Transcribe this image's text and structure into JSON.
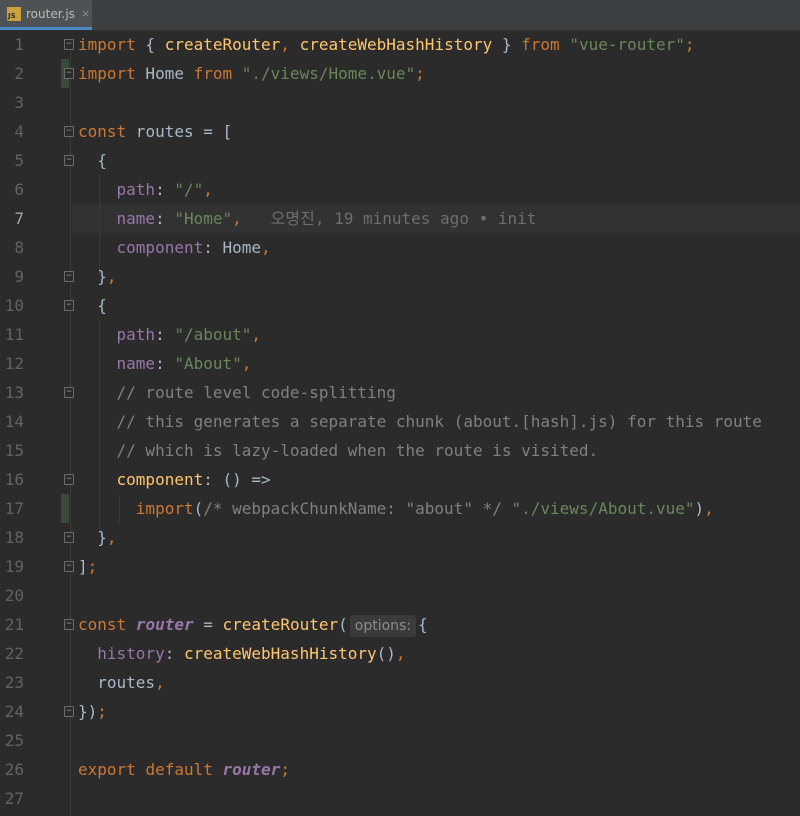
{
  "tab": {
    "name": "router.js",
    "icon": "js-file-icon",
    "close": "×",
    "badge": "JS"
  },
  "gutter": {
    "lines": [
      "1",
      "2",
      "3",
      "4",
      "5",
      "6",
      "7",
      "8",
      "9",
      "10",
      "11",
      "12",
      "13",
      "14",
      "15",
      "16",
      "17",
      "18",
      "19",
      "20",
      "21",
      "22",
      "23",
      "24",
      "25",
      "26",
      "27"
    ]
  },
  "code": {
    "l1": {
      "import": "import",
      "open": " { ",
      "f1": "createRouter",
      "comma": ",",
      "sp": " ",
      "f2": "createWebHashHistory",
      "close": " } ",
      "from": "from",
      "sp2": " ",
      "src": "\"vue-router\"",
      "semi": ";"
    },
    "l2": {
      "import": "import",
      "name": " Home ",
      "from": "from",
      "sp": " ",
      "src": "\"./views/Home.vue\"",
      "semi": ";"
    },
    "l4": {
      "const": "const",
      "rest": " routes = ["
    },
    "l5": {
      "text": "  {"
    },
    "l6": {
      "indent": "    ",
      "key": "path",
      "colon": ": ",
      "val": "\"/\"",
      "comma": ","
    },
    "l7": {
      "indent": "    ",
      "key": "name",
      "colon": ": ",
      "val": "\"Home\"",
      "comma": ",",
      "blame": "   오명진, 19 minutes ago • init"
    },
    "l8": {
      "indent": "    ",
      "key": "component",
      "colon": ": ",
      "val": "Home",
      "comma": ","
    },
    "l9": {
      "text": "  }",
      "comma": ","
    },
    "l10": {
      "text": "  {"
    },
    "l11": {
      "indent": "    ",
      "key": "path",
      "colon": ": ",
      "val": "\"/about\"",
      "comma": ","
    },
    "l12": {
      "indent": "    ",
      "key": "name",
      "colon": ": ",
      "val": "\"About\"",
      "comma": ","
    },
    "l13": {
      "text": "    // route level code-splitting"
    },
    "l14": {
      "text": "    // this generates a separate chunk (about.[hash].js) for this route"
    },
    "l15": {
      "text": "    // which is lazy-loaded when the route is visited."
    },
    "l16": {
      "indent": "    ",
      "key": "component",
      "rest": ": () =>"
    },
    "l17": {
      "indent": "      ",
      "import": "import",
      "paren": "(",
      "cmt": "/* webpackChunkName: \"about\" */",
      "sp": " ",
      "src": "\"./views/About.vue\"",
      "close": ")",
      "comma": ","
    },
    "l18": {
      "text": "  }",
      "comma": ","
    },
    "l19": {
      "text": "]",
      "semi": ";"
    },
    "l21": {
      "const": "const",
      "sp": " ",
      "var": "router",
      "eq": " = ",
      "fn": "createRouter",
      "paren": "(",
      "hint": "options:",
      "brace": "{"
    },
    "l22": {
      "indent": "  ",
      "key": "history",
      "colon": ": ",
      "fn": "createWebHashHistory",
      "call": "()",
      "comma": ","
    },
    "l23": {
      "text": "  routes",
      "comma": ","
    },
    "l24": {
      "text": "})",
      "semi": ";"
    },
    "l26": {
      "export": "export",
      "sp": " ",
      "default": "default",
      "sp2": " ",
      "var": "router",
      "semi": ";"
    }
  },
  "colors": {
    "background": "#2b2b2b",
    "keyword": "#cc7832",
    "string": "#6a8759",
    "property": "#9876aa",
    "function": "#ffc66d",
    "comment": "#808080",
    "text": "#a9b7c6"
  }
}
